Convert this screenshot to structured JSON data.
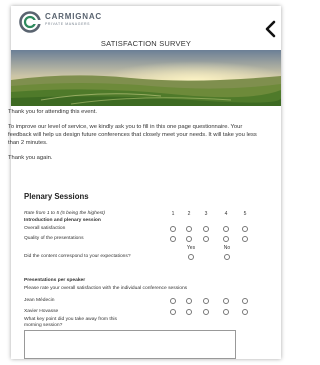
{
  "header": {
    "brand": "CARMIGNAC",
    "tagline": "PRIVATE MANAGERS",
    "survey_title": "SATISFACTION SURVEY",
    "back_icon": "chevron-left-icon"
  },
  "intro": {
    "thanks": "Thank you for attending this event.",
    "body": "To improve our level of service, we kindly ask you to fill in this one page questionnaire. Your feedback will help us design future conferences that closely meet your needs. It will take you less than 2 minutes.",
    "again": "Thank you again."
  },
  "plenary": {
    "title": "Plenary Sessions",
    "rate_hint": "Rate from 1 to 5 (5 being the highest)",
    "scale": [
      "1",
      "2",
      "3",
      "4",
      "5"
    ],
    "intro_heading": "Introduction and plenary session",
    "q_overall": "Overall satisfaction",
    "q_quality": "Quality of the presentations",
    "yes_label": "Yes",
    "no_label": "No",
    "q_content": "Did the content correspond to your expectations?"
  },
  "speakers": {
    "heading": "Presentations per speaker",
    "instruction": "Please rate your overall satisfaction with the individual conference sessions",
    "names": [
      "Jean Médecin",
      "Xavier Hovasse"
    ]
  },
  "keypoint": {
    "question": "What key point did you take away from this morning session?",
    "answer": ""
  },
  "colors": {
    "brand_grey": "#5a6470",
    "logo_green": "#2f8a5e"
  }
}
